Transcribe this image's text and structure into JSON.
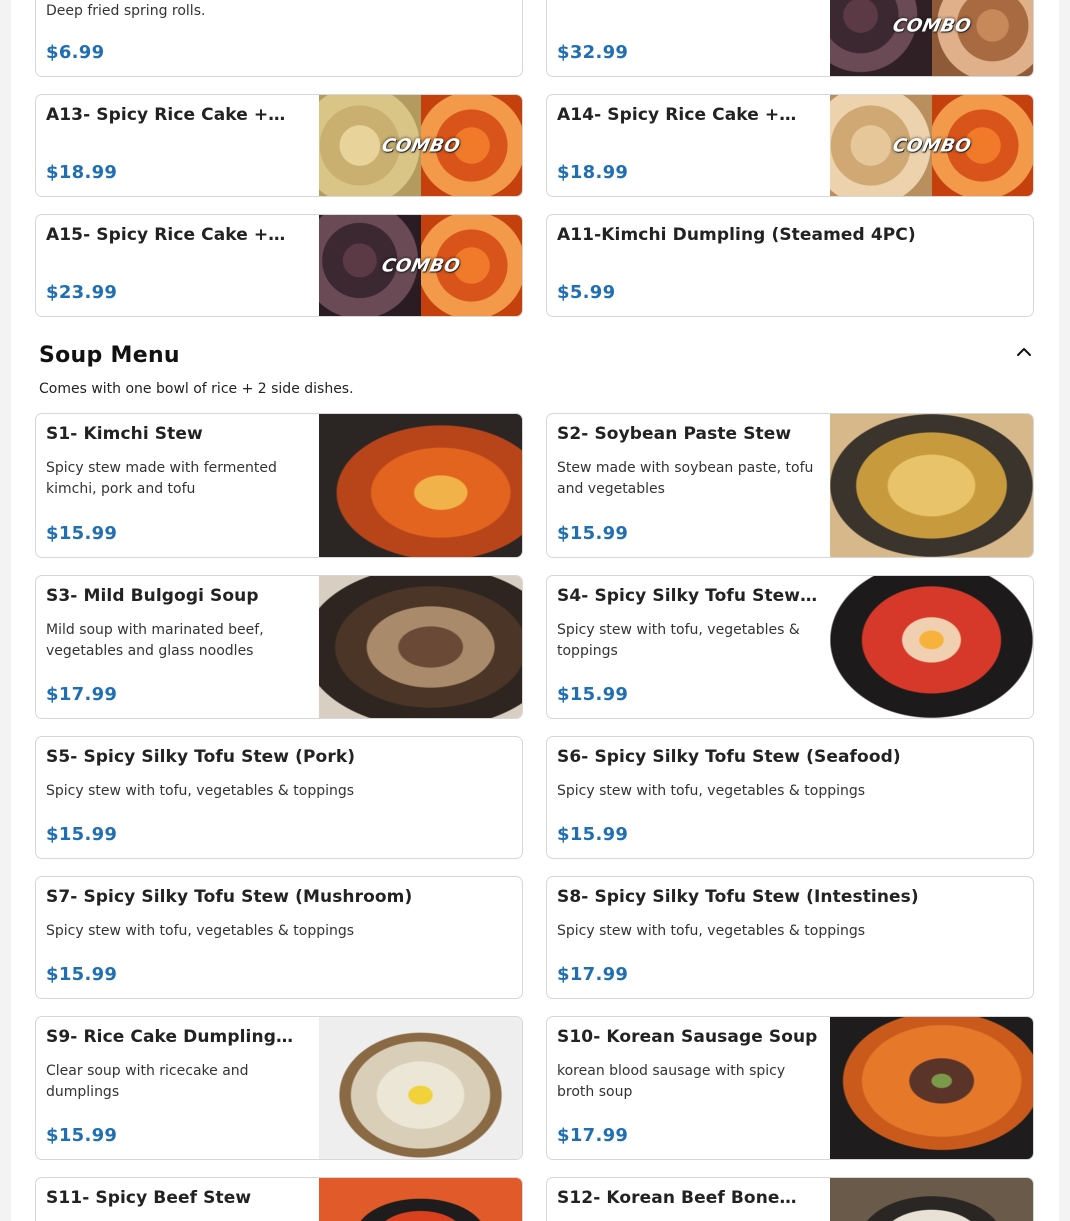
{
  "top_items": [
    {
      "name": "",
      "desc": "Deep fried spring rolls.",
      "price": "$6.99"
    },
    {
      "name": "",
      "desc": "",
      "price": "$32.99",
      "badge": "COMBO"
    },
    {
      "name": "A13- Spicy Rice Cake +…",
      "price": "$18.99",
      "badge": "COMBO"
    },
    {
      "name": "A14- Spicy Rice Cake +…",
      "price": "$18.99",
      "badge": "COMBO"
    },
    {
      "name": "A15- Spicy Rice Cake +…",
      "price": "$23.99",
      "badge": "COMBO"
    },
    {
      "name": "A11-Kimchi Dumpling (Steamed 4PC)",
      "price": "$5.99"
    }
  ],
  "soup_section": {
    "title": "Soup Menu",
    "note": "Comes with one bowl of rice + 2 side dishes.",
    "collapse_icon": "chevron-up-icon"
  },
  "soup_items": [
    {
      "name": "S1- Kimchi Stew",
      "desc": "Spicy stew made with fermented kimchi, pork and tofu",
      "price": "$15.99"
    },
    {
      "name": "S2- Soybean Paste Stew",
      "desc": "Stew made with soybean paste, tofu and vegetables",
      "price": "$15.99"
    },
    {
      "name": "S3- Mild Bulgogi Soup",
      "desc": "Mild soup with marinated beef, vegetables and glass noodles",
      "price": "$17.99"
    },
    {
      "name": "S4- Spicy Silky Tofu Stew…",
      "desc": "Spicy stew with tofu, vegetables & toppings",
      "price": "$15.99"
    },
    {
      "name": "S5- Spicy Silky Tofu Stew (Pork)",
      "desc": "Spicy stew with tofu, vegetables & toppings",
      "price": "$15.99"
    },
    {
      "name": "S6- Spicy Silky Tofu Stew (Seafood)",
      "desc": "Spicy stew with tofu, vegetables & toppings",
      "price": "$15.99"
    },
    {
      "name": "S7- Spicy Silky Tofu Stew (Mushroom)",
      "desc": "Spicy stew with tofu, vegetables & toppings",
      "price": "$15.99"
    },
    {
      "name": "S8- Spicy Silky Tofu Stew (Intestines)",
      "desc": "Spicy stew with tofu, vegetables & toppings",
      "price": "$17.99"
    },
    {
      "name": "S9- Rice Cake Dumpling…",
      "desc": "Clear soup with ricecake and dumplings",
      "price": "$15.99"
    },
    {
      "name": "S10- Korean Sausage Soup",
      "desc": "korean blood sausage with spicy broth soup",
      "price": "$17.99"
    },
    {
      "name": "S11- Spicy Beef Stew",
      "desc": "",
      "price": ""
    },
    {
      "name": "S12- Korean Beef Bone…",
      "desc": "",
      "price": ""
    }
  ],
  "colors": {
    "price": "#1f6fb2",
    "border": "#d7d7d7",
    "background": "#ffffff"
  }
}
